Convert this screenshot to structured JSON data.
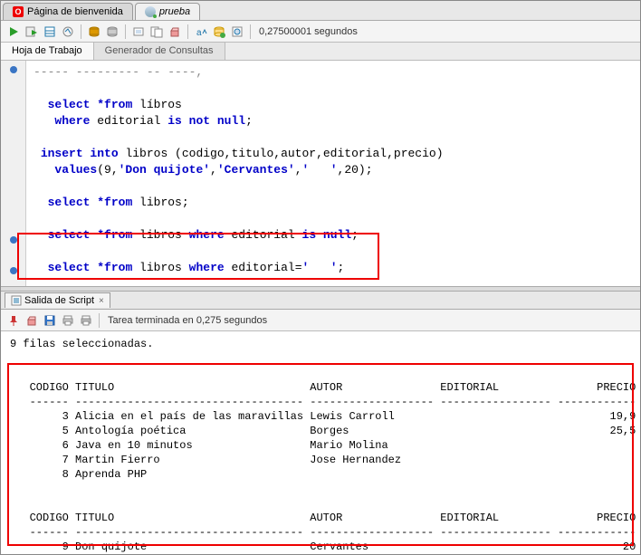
{
  "tabs": {
    "welcome": "Página de bienvenida",
    "file": "prueba"
  },
  "toolbar": {
    "timing": "0,27500001 segundos"
  },
  "subtabs": {
    "worksheet": "Hoja de Trabajo",
    "querybuilder": "Generador de Consultas"
  },
  "code": {
    "line1": "----- --------- -- ----,",
    "sel1_a": "select",
    "sel1_b": "*from",
    "sel1_c": " líbros",
    "sel1w_a": "where",
    "sel1w_b": " editorial ",
    "sel1w_c": "is not null",
    "sel1w_d": ";",
    "ins_a": "insert into",
    "ins_b": " libros (codigo,titulo,autor,editorial,precio)",
    "val_a": "values",
    "val_b": "(9,",
    "val_c": "'Don quijote'",
    "val_d": ",",
    "val_e": "'Cervantes'",
    "val_f": ",",
    "val_g": "'   '",
    "val_h": ",20);",
    "sel2_a": "select",
    "sel2_b": "*from",
    "sel2_c": " libros;",
    "sel3_a": "select",
    "sel3_b": "*from",
    "sel3_c": " libros ",
    "sel3_d": "where",
    "sel3_e": " editorial ",
    "sel3_f": "is null",
    "sel3_g": ";",
    "sel4_a": "select",
    "sel4_b": "*from",
    "sel4_c": " libros ",
    "sel4_d": "where",
    "sel4_e": " editorial=",
    "sel4_f": "'   '",
    "sel4_g": ";"
  },
  "outtab": {
    "label": "Salida de Script"
  },
  "outtoolbar": {
    "status": "Tarea terminada en 0,275 segundos"
  },
  "result": {
    "rowcount": "9 filas seleccionadas.",
    "header": "CODIGO TITULO                              AUTOR               EDITORIAL               PRECIO",
    "dashes": "------ ----------------------------------- ------------------- ----------------- ------------",
    "r1": "     3 Alicia en el país de las maravillas Lewis Carroll                                 19,9",
    "r2": "     5 Antología poética                   Borges                                        25,5",
    "r3": "     6 Java en 10 minutos                  Mario Molina",
    "r4": "     7 Martin Fierro                       Jose Hernandez",
    "r5": "     8 Aprenda PHP",
    "r6": "     9 Don quijote                         Cervantes                                       20"
  }
}
